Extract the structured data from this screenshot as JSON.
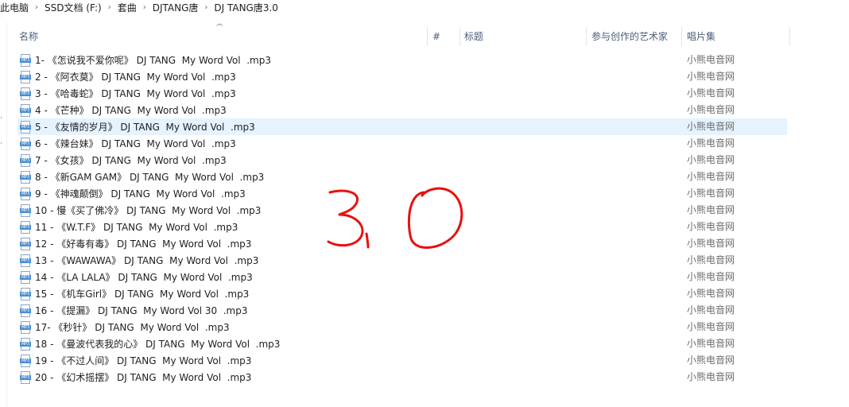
{
  "breadcrumb": [
    {
      "label": "此电脑"
    },
    {
      "label": "SSD文档 (F:)"
    },
    {
      "label": "套曲"
    },
    {
      "label": "DJTANG唐"
    },
    {
      "label": "DJ TANG唐3.0"
    }
  ],
  "breadcrumb_separator": "›",
  "sort_indicator": "^",
  "columns": {
    "name": "名称",
    "track": "#",
    "title": "标题",
    "artists": "参与创作的艺术家",
    "album": "唱片集"
  },
  "file_type_icon_label": "MP3",
  "files": [
    {
      "name": "1- 《怎说我不爱你呢》 DJ TANG  My Word Vol  .mp3",
      "album": "小熊电音网"
    },
    {
      "name": "2 - 《阿衣莫》 DJ TANG  My Word Vol  .mp3",
      "album": "小熊电音网"
    },
    {
      "name": "3 - 《哈毒蛇》 DJ TANG  My Word Vol  .mp3",
      "album": "小熊电音网"
    },
    {
      "name": "4 - 《芒种》 DJ TANG  My Word Vol  .mp3",
      "album": "小熊电音网"
    },
    {
      "name": "5 - 《友情的岁月》 DJ TANG  My Word Vol  .mp3",
      "album": "小熊电音网",
      "selected": true
    },
    {
      "name": "6 - 《辣台妹》 DJ TANG  My Word Vol  .mp3",
      "album": "小熊电音网"
    },
    {
      "name": "7 - 《女孩》 DJ TANG  My Word Vol  .mp3",
      "album": "小熊电音网"
    },
    {
      "name": "8 - 《新GAM GAM》 DJ TANG  My Word Vol  .mp3",
      "album": "小熊电音网"
    },
    {
      "name": "9 - 《神魂颠倒》 DJ TANG  My Word Vol  .mp3",
      "album": "小熊电音网"
    },
    {
      "name": "10 - 慢《买了佛冷》 DJ TANG  My Word Vol  .mp3",
      "album": "小熊电音网"
    },
    {
      "name": "11 - 《W.T.F》 DJ TANG  My Word Vol  .mp3",
      "album": "小熊电音网"
    },
    {
      "name": "12 - 《好毒有毒》 DJ TANG  My Word Vol  .mp3",
      "album": "小熊电音网"
    },
    {
      "name": "13 - 《WAWAWA》 DJ TANG  My Word Vol  .mp3",
      "album": "小熊电音网"
    },
    {
      "name": "14 - 《LA LALA》 DJ TANG  My Word Vol  .mp3",
      "album": "小熊电音网"
    },
    {
      "name": "15 - 《机车Girl》 DJ TANG  My Word Vol  .mp3",
      "album": "小熊电音网"
    },
    {
      "name": "16 - 《提漏》 DJ TANG  My Word Vol 30  .mp3",
      "album": "小熊电音网"
    },
    {
      "name": "17- 《秒针》 DJ TANG  My Word Vol  .mp3",
      "album": "小熊电音网"
    },
    {
      "name": "18 - 《曼波代表我的心》 DJ TANG  My Word Vol  .mp3",
      "album": "小熊电音网"
    },
    {
      "name": "19 - 《不过人间》 DJ TANG  My Word Vol  .mp3",
      "album": "小熊电音网"
    },
    {
      "name": "20 - 《幻术摇摆》 DJ TANG  My Word Vol  .mp3",
      "album": "小熊电音网"
    }
  ],
  "handwriting": "3.0",
  "colors": {
    "selected_row": "#e5f3ff",
    "header_text": "#4c607a",
    "album_text": "#6d6d6d",
    "handwriting": "#e81010",
    "icon_band": "#4a8ed1"
  }
}
